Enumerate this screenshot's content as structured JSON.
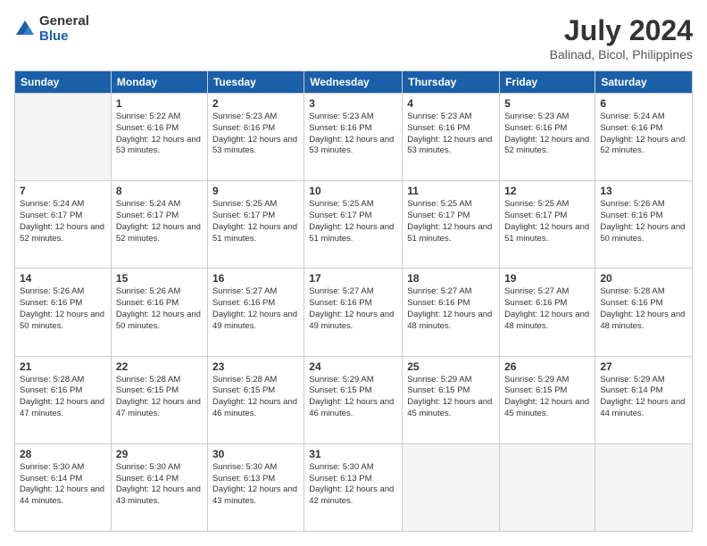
{
  "header": {
    "logo_general": "General",
    "logo_blue": "Blue",
    "month_year": "July 2024",
    "location": "Balinad, Bicol, Philippines"
  },
  "days_of_week": [
    "Sunday",
    "Monday",
    "Tuesday",
    "Wednesday",
    "Thursday",
    "Friday",
    "Saturday"
  ],
  "weeks": [
    [
      {
        "day": "",
        "sunrise": "",
        "sunset": "",
        "daylight": ""
      },
      {
        "day": "1",
        "sunrise": "Sunrise: 5:22 AM",
        "sunset": "Sunset: 6:16 PM",
        "daylight": "Daylight: 12 hours and 53 minutes."
      },
      {
        "day": "2",
        "sunrise": "Sunrise: 5:23 AM",
        "sunset": "Sunset: 6:16 PM",
        "daylight": "Daylight: 12 hours and 53 minutes."
      },
      {
        "day": "3",
        "sunrise": "Sunrise: 5:23 AM",
        "sunset": "Sunset: 6:16 PM",
        "daylight": "Daylight: 12 hours and 53 minutes."
      },
      {
        "day": "4",
        "sunrise": "Sunrise: 5:23 AM",
        "sunset": "Sunset: 6:16 PM",
        "daylight": "Daylight: 12 hours and 53 minutes."
      },
      {
        "day": "5",
        "sunrise": "Sunrise: 5:23 AM",
        "sunset": "Sunset: 6:16 PM",
        "daylight": "Daylight: 12 hours and 52 minutes."
      },
      {
        "day": "6",
        "sunrise": "Sunrise: 5:24 AM",
        "sunset": "Sunset: 6:16 PM",
        "daylight": "Daylight: 12 hours and 52 minutes."
      }
    ],
    [
      {
        "day": "7",
        "sunrise": "Sunrise: 5:24 AM",
        "sunset": "Sunset: 6:17 PM",
        "daylight": "Daylight: 12 hours and 52 minutes."
      },
      {
        "day": "8",
        "sunrise": "Sunrise: 5:24 AM",
        "sunset": "Sunset: 6:17 PM",
        "daylight": "Daylight: 12 hours and 52 minutes."
      },
      {
        "day": "9",
        "sunrise": "Sunrise: 5:25 AM",
        "sunset": "Sunset: 6:17 PM",
        "daylight": "Daylight: 12 hours and 51 minutes."
      },
      {
        "day": "10",
        "sunrise": "Sunrise: 5:25 AM",
        "sunset": "Sunset: 6:17 PM",
        "daylight": "Daylight: 12 hours and 51 minutes."
      },
      {
        "day": "11",
        "sunrise": "Sunrise: 5:25 AM",
        "sunset": "Sunset: 6:17 PM",
        "daylight": "Daylight: 12 hours and 51 minutes."
      },
      {
        "day": "12",
        "sunrise": "Sunrise: 5:25 AM",
        "sunset": "Sunset: 6:17 PM",
        "daylight": "Daylight: 12 hours and 51 minutes."
      },
      {
        "day": "13",
        "sunrise": "Sunrise: 5:26 AM",
        "sunset": "Sunset: 6:16 PM",
        "daylight": "Daylight: 12 hours and 50 minutes."
      }
    ],
    [
      {
        "day": "14",
        "sunrise": "Sunrise: 5:26 AM",
        "sunset": "Sunset: 6:16 PM",
        "daylight": "Daylight: 12 hours and 50 minutes."
      },
      {
        "day": "15",
        "sunrise": "Sunrise: 5:26 AM",
        "sunset": "Sunset: 6:16 PM",
        "daylight": "Daylight: 12 hours and 50 minutes."
      },
      {
        "day": "16",
        "sunrise": "Sunrise: 5:27 AM",
        "sunset": "Sunset: 6:16 PM",
        "daylight": "Daylight: 12 hours and 49 minutes."
      },
      {
        "day": "17",
        "sunrise": "Sunrise: 5:27 AM",
        "sunset": "Sunset: 6:16 PM",
        "daylight": "Daylight: 12 hours and 49 minutes."
      },
      {
        "day": "18",
        "sunrise": "Sunrise: 5:27 AM",
        "sunset": "Sunset: 6:16 PM",
        "daylight": "Daylight: 12 hours and 48 minutes."
      },
      {
        "day": "19",
        "sunrise": "Sunrise: 5:27 AM",
        "sunset": "Sunset: 6:16 PM",
        "daylight": "Daylight: 12 hours and 48 minutes."
      },
      {
        "day": "20",
        "sunrise": "Sunrise: 5:28 AM",
        "sunset": "Sunset: 6:16 PM",
        "daylight": "Daylight: 12 hours and 48 minutes."
      }
    ],
    [
      {
        "day": "21",
        "sunrise": "Sunrise: 5:28 AM",
        "sunset": "Sunset: 6:16 PM",
        "daylight": "Daylight: 12 hours and 47 minutes."
      },
      {
        "day": "22",
        "sunrise": "Sunrise: 5:28 AM",
        "sunset": "Sunset: 6:15 PM",
        "daylight": "Daylight: 12 hours and 47 minutes."
      },
      {
        "day": "23",
        "sunrise": "Sunrise: 5:28 AM",
        "sunset": "Sunset: 6:15 PM",
        "daylight": "Daylight: 12 hours and 46 minutes."
      },
      {
        "day": "24",
        "sunrise": "Sunrise: 5:29 AM",
        "sunset": "Sunset: 6:15 PM",
        "daylight": "Daylight: 12 hours and 46 minutes."
      },
      {
        "day": "25",
        "sunrise": "Sunrise: 5:29 AM",
        "sunset": "Sunset: 6:15 PM",
        "daylight": "Daylight: 12 hours and 45 minutes."
      },
      {
        "day": "26",
        "sunrise": "Sunrise: 5:29 AM",
        "sunset": "Sunset: 6:15 PM",
        "daylight": "Daylight: 12 hours and 45 minutes."
      },
      {
        "day": "27",
        "sunrise": "Sunrise: 5:29 AM",
        "sunset": "Sunset: 6:14 PM",
        "daylight": "Daylight: 12 hours and 44 minutes."
      }
    ],
    [
      {
        "day": "28",
        "sunrise": "Sunrise: 5:30 AM",
        "sunset": "Sunset: 6:14 PM",
        "daylight": "Daylight: 12 hours and 44 minutes."
      },
      {
        "day": "29",
        "sunrise": "Sunrise: 5:30 AM",
        "sunset": "Sunset: 6:14 PM",
        "daylight": "Daylight: 12 hours and 43 minutes."
      },
      {
        "day": "30",
        "sunrise": "Sunrise: 5:30 AM",
        "sunset": "Sunset: 6:13 PM",
        "daylight": "Daylight: 12 hours and 43 minutes."
      },
      {
        "day": "31",
        "sunrise": "Sunrise: 5:30 AM",
        "sunset": "Sunset: 6:13 PM",
        "daylight": "Daylight: 12 hours and 42 minutes."
      },
      {
        "day": "",
        "sunrise": "",
        "sunset": "",
        "daylight": ""
      },
      {
        "day": "",
        "sunrise": "",
        "sunset": "",
        "daylight": ""
      },
      {
        "day": "",
        "sunrise": "",
        "sunset": "",
        "daylight": ""
      }
    ]
  ]
}
